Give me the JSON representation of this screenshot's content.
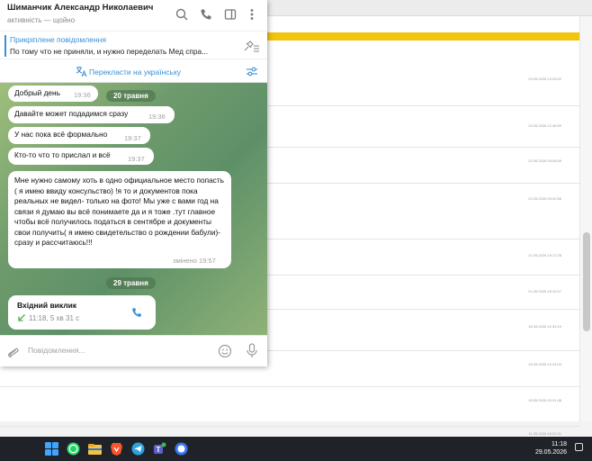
{
  "chat": {
    "name": "Шиманчик Александр Николаевич",
    "status": "активність — щойно"
  },
  "pinned": {
    "title": "Прикріплене повідомлення",
    "text": "По тому что не приняли, и нужно переделать Мед спра..."
  },
  "translate": {
    "label": "Перекласти на українську"
  },
  "messages": [
    {
      "text": "Добрый день",
      "time": "19:36"
    },
    {
      "text": "Давайте может подадимся сразу",
      "time": "19:36"
    },
    {
      "text": "У нас пока всё формально",
      "time": "19:37"
    },
    {
      "text": "Кто-то что то прислал и всё",
      "time": "19:37"
    },
    {
      "text": "Мне нужно самому хоть в одно официальное место попасть ( я имею ввиду консульство)  !я то и документов пока реальных не видел- только на фото! Мы уже с вами год на связи я думаю вы всё понимаете да и я тоже .тут главное чтобы всё получилось податься в сентябре и документы свои получить( я имею свидетельство о рождении бабули)- сразу и рассчитаюсь!!!",
      "time": "змінено 19:57"
    }
  ],
  "dates": {
    "d1": "20 травня",
    "d2": "29 травня"
  },
  "call": {
    "title": "Вхідний виклик",
    "info": "11:18, 5 хв 31 с"
  },
  "composer": {
    "placeholder": "Повідомлення..."
  },
  "taskbar": {
    "time": "11:18",
    "date": "29.05.2026"
  },
  "background_dates": [
    "29.05.2026 13:23:02",
    "24.05.2026 12:46:59",
    "22.05.2026 09:36:05",
    "22.05.2026 09:32:56",
    "21.05.2026 19:17:28",
    "21.05.2026 19:12:07",
    "18.05.2026 12:34:19",
    "18.05.2026 12:34:03",
    "18.05.2026 10:31:48",
    "11.05.2026 16:22:51"
  ],
  "colors": {
    "accent": "#3a8fd6",
    "yellow": "#f1c40f",
    "call_green": "#4caf50"
  }
}
